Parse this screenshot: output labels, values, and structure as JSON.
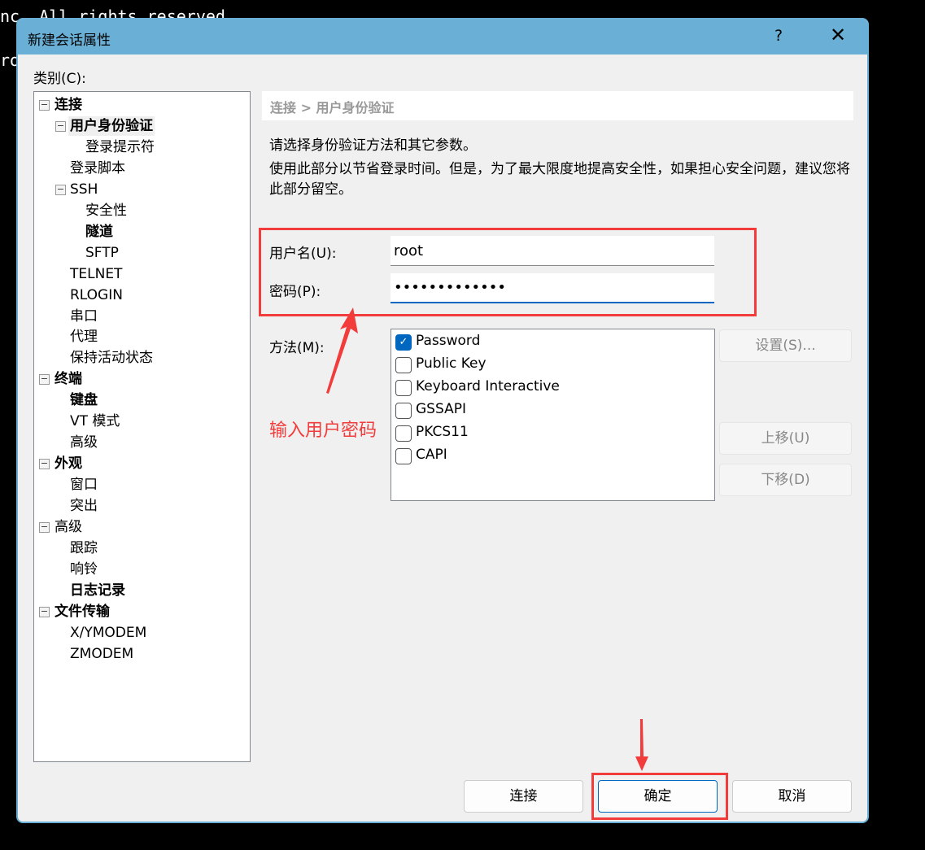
{
  "terminal": {
    "line1": "nc. All rights reserved",
    "line2": "ro"
  },
  "window": {
    "title": "新建会话属性",
    "help": "?",
    "close": "✕",
    "accent": "#6aafd6"
  },
  "category_label": "类别(C):",
  "tree": [
    {
      "label": "连接",
      "level": 0,
      "bold": true,
      "expander": true
    },
    {
      "label": "用户身份验证",
      "level": 1,
      "bold": true,
      "expander": true,
      "selected": true
    },
    {
      "label": "登录提示符",
      "level": 2
    },
    {
      "label": "登录脚本",
      "level": 1
    },
    {
      "label": "SSH",
      "level": 1,
      "expander": true
    },
    {
      "label": "安全性",
      "level": 2
    },
    {
      "label": "隧道",
      "level": 2,
      "bold": true
    },
    {
      "label": "SFTP",
      "level": 2
    },
    {
      "label": "TELNET",
      "level": 1
    },
    {
      "label": "RLOGIN",
      "level": 1
    },
    {
      "label": "串口",
      "level": 1
    },
    {
      "label": "代理",
      "level": 1
    },
    {
      "label": "保持活动状态",
      "level": 1
    },
    {
      "label": "终端",
      "level": 0,
      "bold": true,
      "expander": true
    },
    {
      "label": "键盘",
      "level": 1,
      "bold": true
    },
    {
      "label": "VT 模式",
      "level": 1
    },
    {
      "label": "高级",
      "level": 1
    },
    {
      "label": "外观",
      "level": 0,
      "bold": true,
      "expander": true
    },
    {
      "label": "窗口",
      "level": 1
    },
    {
      "label": "突出",
      "level": 1
    },
    {
      "label": "高级",
      "level": 0,
      "expander": true
    },
    {
      "label": "跟踪",
      "level": 1
    },
    {
      "label": "响铃",
      "level": 1
    },
    {
      "label": "日志记录",
      "level": 1,
      "bold": true
    },
    {
      "label": "文件传输",
      "level": 0,
      "bold": true,
      "expander": true
    },
    {
      "label": "X/YMODEM",
      "level": 1
    },
    {
      "label": "ZMODEM",
      "level": 1
    }
  ],
  "main": {
    "breadcrumb": "连接 > 用户身份验证",
    "desc1": "请选择身份验证方法和其它参数。",
    "desc2": "使用此部分以节省登录时间。但是，为了最大限度地提高安全性，如果担心安全问题，建议您将此部分留空。",
    "username_label": "用户名(U):",
    "username_value": "root",
    "password_label": "密码(P):",
    "password_value": "•••••••••••••",
    "method_label": "方法(M):",
    "methods": [
      {
        "label": "Password",
        "checked": true
      },
      {
        "label": "Public Key",
        "checked": false
      },
      {
        "label": "Keyboard Interactive",
        "checked": false
      },
      {
        "label": "GSSAPI",
        "checked": false
      },
      {
        "label": "PKCS11",
        "checked": false
      },
      {
        "label": "CAPI",
        "checked": false
      }
    ],
    "settings_button": "设置(S)...",
    "up_button": "上移(U)",
    "down_button": "下移(D)"
  },
  "annotation": {
    "text": "输入用户密码",
    "color": "#f23c3c"
  },
  "buttons": {
    "connect": "连接",
    "ok": "确定",
    "cancel": "取消"
  }
}
